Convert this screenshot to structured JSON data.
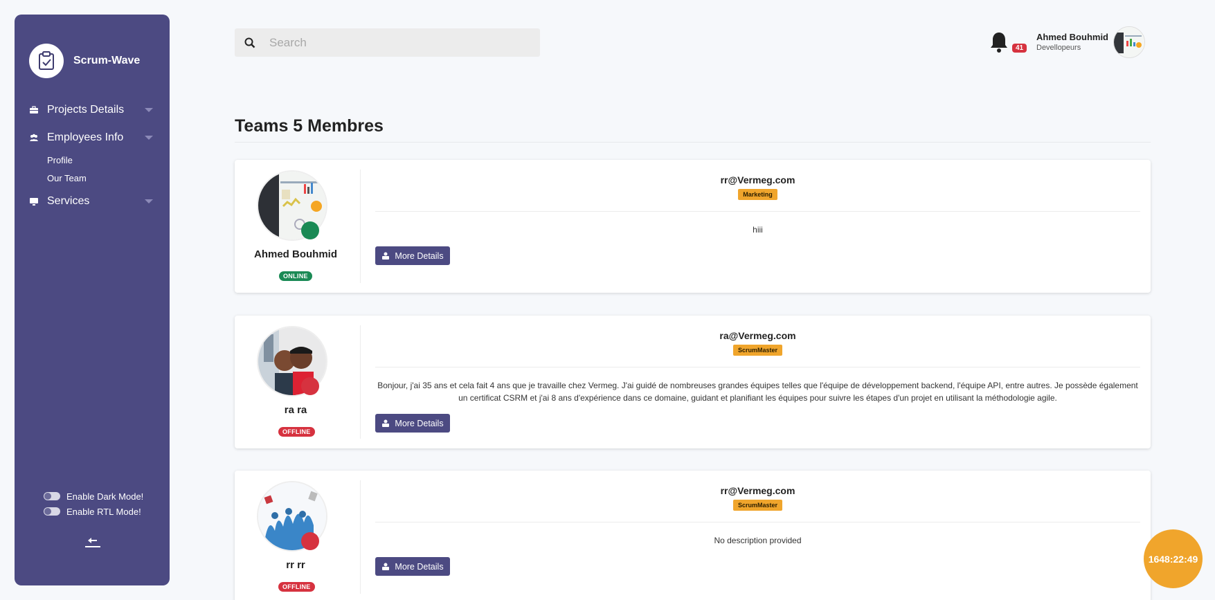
{
  "app": {
    "name": "Scrum-Wave"
  },
  "sidebar": {
    "items": [
      {
        "label": "Projects Details",
        "icon": "briefcase-icon"
      },
      {
        "label": "Employees Info",
        "icon": "users-icon"
      },
      {
        "label": "Services",
        "icon": "monitor-icon"
      }
    ],
    "sub_items": [
      "Profile",
      "Our Team"
    ],
    "toggles": [
      "Enable Dark Mode!",
      "Enable RTL Mode!"
    ]
  },
  "search": {
    "placeholder": "Search",
    "value": ""
  },
  "header": {
    "notification_count": "41",
    "user_name": "Ahmed Bouhmid",
    "user_role": "Devellopeurs"
  },
  "page": {
    "title": "Teams 5 Membres"
  },
  "members": [
    {
      "name": "Ahmed Bouhmid",
      "status": "ONLINE",
      "email": "rr@Vermeg.com",
      "role": "Marketing",
      "description": "hiii",
      "button": "More Details"
    },
    {
      "name": "ra ra",
      "status": "OFFLINE",
      "email": "ra@Vermeg.com",
      "role": "ScrumMaster",
      "description": "Bonjour, j'ai 35 ans et cela fait 4 ans que je travaille chez Vermeg. J'ai guidé de nombreuses grandes équipes telles que l'équipe de développement backend, l'équipe API, entre autres. Je possède également un certificat CSRM et j'ai 8 ans d'expérience dans ce domaine, guidant et planifiant les équipes pour suivre les étapes d'un projet en utilisant la méthodologie agile.",
      "button": "More Details"
    },
    {
      "name": "rr rr",
      "status": "OFFLINE",
      "email": "rr@Vermeg.com",
      "role": "ScrumMaster",
      "description": "No description provided",
      "button": "More Details"
    }
  ],
  "timer": "1648:22:49",
  "colors": {
    "sidebar": "#4c4a82",
    "accent": "#f0a52c",
    "online": "#1a8a55",
    "offline": "#d6323f"
  }
}
